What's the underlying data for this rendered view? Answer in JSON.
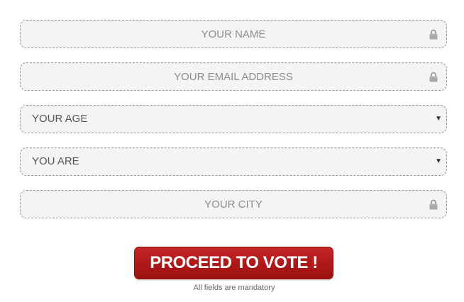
{
  "form": {
    "name_placeholder": "YOUR NAME",
    "email_placeholder": "YOUR EMAIL ADDRESS",
    "age_selected": "YOUR AGE",
    "gender_selected": "YOU ARE",
    "city_placeholder": "YOUR CITY",
    "submit_label": "PROCEED TO VOTE !",
    "mandatory_note": "All fields are mandatory"
  },
  "icons": {
    "field_lock": "lock-icon",
    "select_caret": "chevron-down-icon"
  },
  "colors": {
    "button_red": "#ad1717",
    "field_bg": "#f4f4f4",
    "field_border": "#9a9a9a"
  }
}
